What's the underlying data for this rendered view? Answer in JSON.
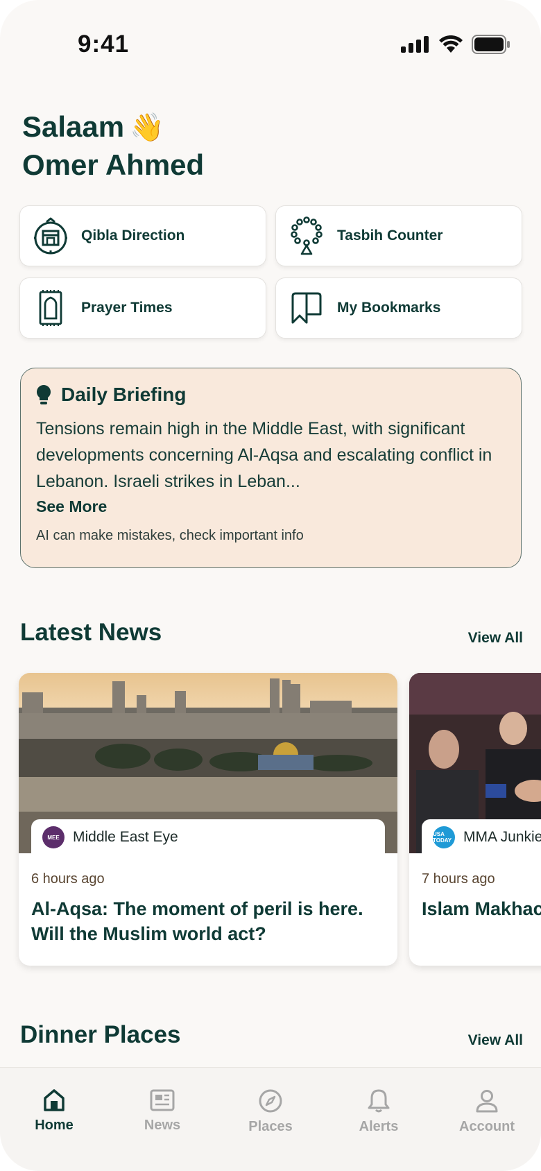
{
  "status_bar": {
    "time": "9:41"
  },
  "greeting": {
    "line1": "Salaam",
    "emoji": "👋",
    "line2": "Omer Ahmed"
  },
  "quick_actions": [
    {
      "label": "Qibla Direction",
      "icon": "compass-qibla-icon"
    },
    {
      "label": "Tasbih Counter",
      "icon": "prayer-beads-icon"
    },
    {
      "label": "Prayer Times",
      "icon": "prayer-mat-icon"
    },
    {
      "label": "My Bookmarks",
      "icon": "bookmark-icon"
    }
  ],
  "briefing": {
    "title": "Daily Briefing",
    "text": "Tensions remain high in the Middle East, with significant developments concerning Al-Aqsa and escalating conflict in Lebanon. Israeli strikes in Leban...",
    "see_more": "See More",
    "disclaimer": "AI can make mistakes, check important info"
  },
  "latest_news": {
    "title": "Latest News",
    "view_all": "View All",
    "items": [
      {
        "source": "Middle East Eye",
        "source_logo": "MEE",
        "time": "6 hours ago",
        "title": "Al-Aqsa: The moment of peril is here. Will the Muslim world act?"
      },
      {
        "source": "MMA Junkie",
        "source_logo": "USA TODAY",
        "time": "7 hours ago",
        "title": "Islam Makhachev defense vs. la"
      }
    ]
  },
  "dinner_places": {
    "title": "Dinner Places",
    "view_all": "View All"
  },
  "tabs": [
    {
      "label": "Home",
      "icon": "home-icon",
      "active": true
    },
    {
      "label": "News",
      "icon": "newspaper-icon",
      "active": false
    },
    {
      "label": "Places",
      "icon": "compass-icon",
      "active": false
    },
    {
      "label": "Alerts",
      "icon": "bell-icon",
      "active": false
    },
    {
      "label": "Account",
      "icon": "person-icon",
      "active": false
    }
  ],
  "colors": {
    "primary": "#0f3a35",
    "briefing_bg": "#f9e9dc",
    "inactive_tab": "#a6a6a6",
    "background": "#faf8f6"
  }
}
